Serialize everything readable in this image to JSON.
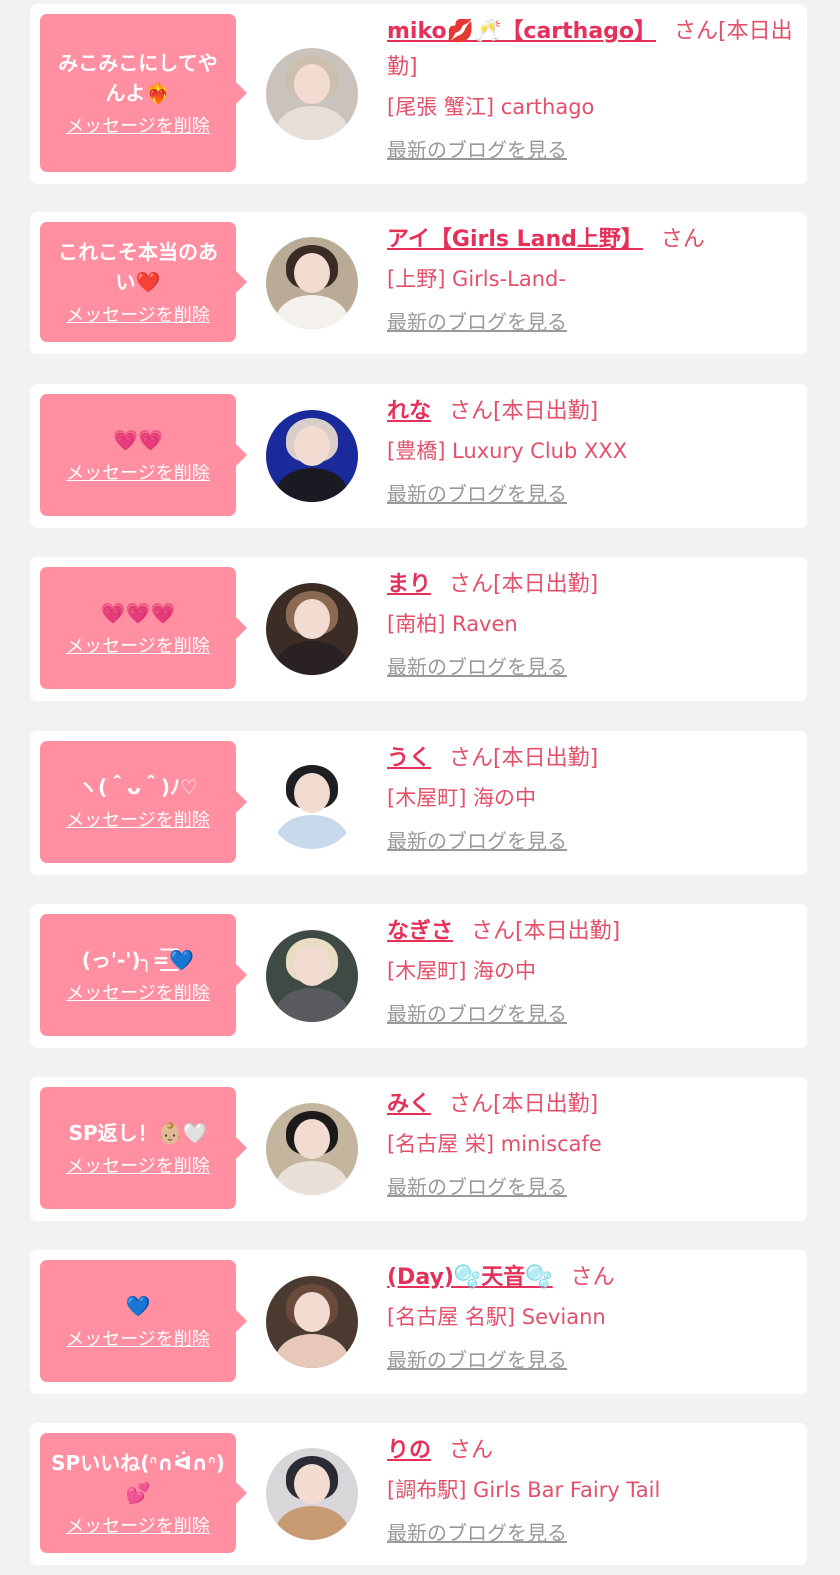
{
  "rows": [
    {
      "message": "みこみこにしてやんよ❤️‍🔥",
      "delete_label": "メッセージを削除",
      "name": "miko💋🥂【carthago】",
      "honorific": "さん",
      "status": "[本日出勤]",
      "shop": "[尾張 蟹江] carthago",
      "blog_link": "最新のブログを見る",
      "avatar": {
        "bg": "#c9c2bd",
        "hair": "#cdbfae",
        "body": "#e8e0d8"
      }
    },
    {
      "message": "これこそ本当のあい❤️",
      "delete_label": "メッセージを削除",
      "name": "アイ【Girls Land上野】",
      "honorific": "さん",
      "status": "",
      "shop": "[上野] Girls-Land-",
      "blog_link": "最新のブログを見る",
      "avatar": {
        "bg": "#b9ab96",
        "hair": "#3a2c24",
        "body": "#f4f1ec"
      }
    },
    {
      "message": "💗💗",
      "delete_label": "メッセージを削除",
      "name": "れな",
      "honorific": "さん",
      "status": "[本日出勤]",
      "shop": "[豊橋] Luxury Club XXX",
      "blog_link": "最新のブログを見る",
      "avatar": {
        "bg": "#1a2a9a",
        "hair": "#d8cfc8",
        "body": "#1a1a22"
      }
    },
    {
      "message": "💗💗💗",
      "delete_label": "メッセージを削除",
      "name": "まり",
      "honorific": "さん",
      "status": "[本日出勤]",
      "shop": "[南柏] Raven",
      "blog_link": "最新のブログを見る",
      "avatar": {
        "bg": "#3b2c26",
        "hair": "#8a6a52",
        "body": "#2a2222"
      }
    },
    {
      "message": "ヽ(＾ᴗ＾)ﾉ♡",
      "delete_label": "メッセージを削除",
      "name": "うく",
      "honorific": "さん",
      "status": "[本日出勤]",
      "shop": "[木屋町] 海の中",
      "blog_link": "最新のブログを見る",
      "avatar": {
        "bg": "#ffffff",
        "hair": "#1e1e22",
        "body": "#c7d9ea"
      }
    },
    {
      "message": "(っ'-')╮=͟͟͞͞💙",
      "delete_label": "メッセージを削除",
      "name": "なぎさ",
      "honorific": "さん",
      "status": "[本日出勤]",
      "shop": "[木屋町] 海の中",
      "blog_link": "最新のブログを見る",
      "avatar": {
        "bg": "#3f4a44",
        "hair": "#e9dcc3",
        "body": "#5a5a60"
      }
    },
    {
      "message": "SP返し！👶🏼🤍",
      "delete_label": "メッセージを削除",
      "name": "みく",
      "honorific": "さん",
      "status": "[本日出勤]",
      "shop": "[名古屋 栄] miniscafe",
      "blog_link": "最新のブログを見る",
      "avatar": {
        "bg": "#c4b59e",
        "hair": "#1c1a1a",
        "body": "#e9e0d8"
      }
    },
    {
      "message": "💙",
      "delete_label": "メッセージを削除",
      "name": "(Day)🫧天音🫧",
      "honorific": "さん",
      "status": "",
      "shop": "[名古屋 名駅] Seviann",
      "blog_link": "最新のブログを見る",
      "avatar": {
        "bg": "#4a3a30",
        "hair": "#6a4a3a",
        "body": "#e8c9b9"
      }
    },
    {
      "message": "SPいいね(ᐢ∩ᐛ∩ᐢ)💕",
      "delete_label": "メッセージを削除",
      "name": "りの",
      "honorific": "さん",
      "status": "",
      "shop": "[調布駅] Girls Bar Fairy Tail",
      "blog_link": "最新のブログを見る",
      "avatar": {
        "bg": "#d9d6da",
        "hair": "#2a2a34",
        "body": "#c89a72"
      }
    }
  ]
}
